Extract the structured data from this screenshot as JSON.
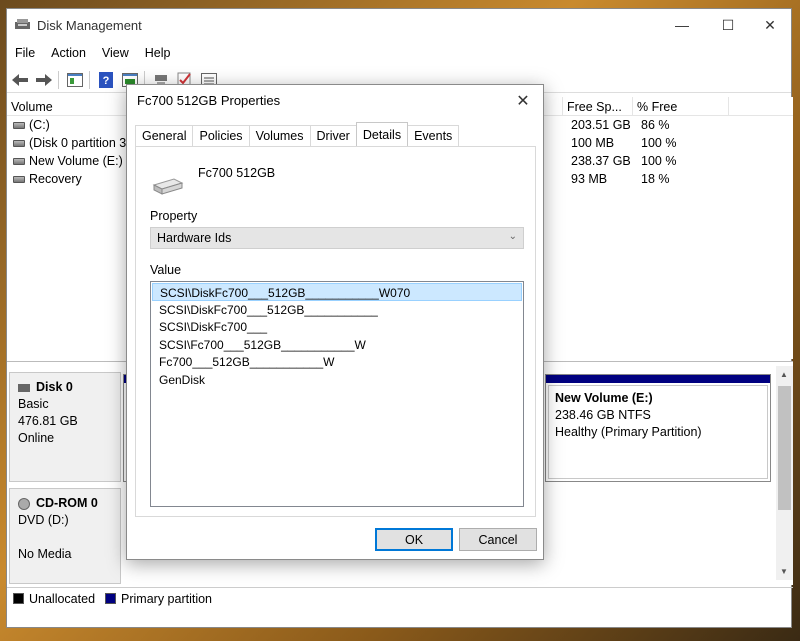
{
  "window": {
    "title": "Disk Management",
    "minimize": "—",
    "maximize": "☐",
    "close": "✕"
  },
  "menu": [
    "File",
    "Action",
    "View",
    "Help"
  ],
  "volume_table": {
    "columns": [
      "Volume",
      "Free Sp...",
      "% Free"
    ],
    "rows": [
      {
        "volume": "(C:)",
        "free": "203.51 GB",
        "pct": "86 %"
      },
      {
        "volume": "(Disk 0 partition 3)",
        "free": "100 MB",
        "pct": "100 %"
      },
      {
        "volume": "New Volume (E:)",
        "free": "238.37 GB",
        "pct": "100 %"
      },
      {
        "volume": "Recovery",
        "free": "93 MB",
        "pct": "18 %"
      }
    ]
  },
  "disks": [
    {
      "name": "Disk 0",
      "lines": [
        "Basic",
        "476.81 GB",
        "Online"
      ]
    },
    {
      "name": "CD-ROM 0",
      "lines": [
        "DVD (D:)",
        "",
        "No Media"
      ]
    }
  ],
  "partition": {
    "name": "New Volume  (E:)",
    "size": "238.46 GB NTFS",
    "status": "Healthy (Primary Partition)"
  },
  "legend": [
    {
      "label": "Unallocated",
      "color": "#000000"
    },
    {
      "label": "Primary partition",
      "color": "#000080"
    }
  ],
  "dialog": {
    "title": "Fc700 512GB Properties",
    "close": "✕",
    "tabs": [
      "General",
      "Policies",
      "Volumes",
      "Driver",
      "Details",
      "Events"
    ],
    "active_tab": "Details",
    "device_name": "Fc700 512GB",
    "property_label": "Property",
    "property_value": "Hardware Ids",
    "value_label": "Value",
    "values": [
      "SCSI\\DiskFc700___512GB___________W070",
      "SCSI\\DiskFc700___512GB___________",
      "SCSI\\DiskFc700___",
      "SCSI\\Fc700___512GB___________W",
      "Fc700___512GB___________W",
      "GenDisk"
    ],
    "ok": "OK",
    "cancel": "Cancel"
  }
}
